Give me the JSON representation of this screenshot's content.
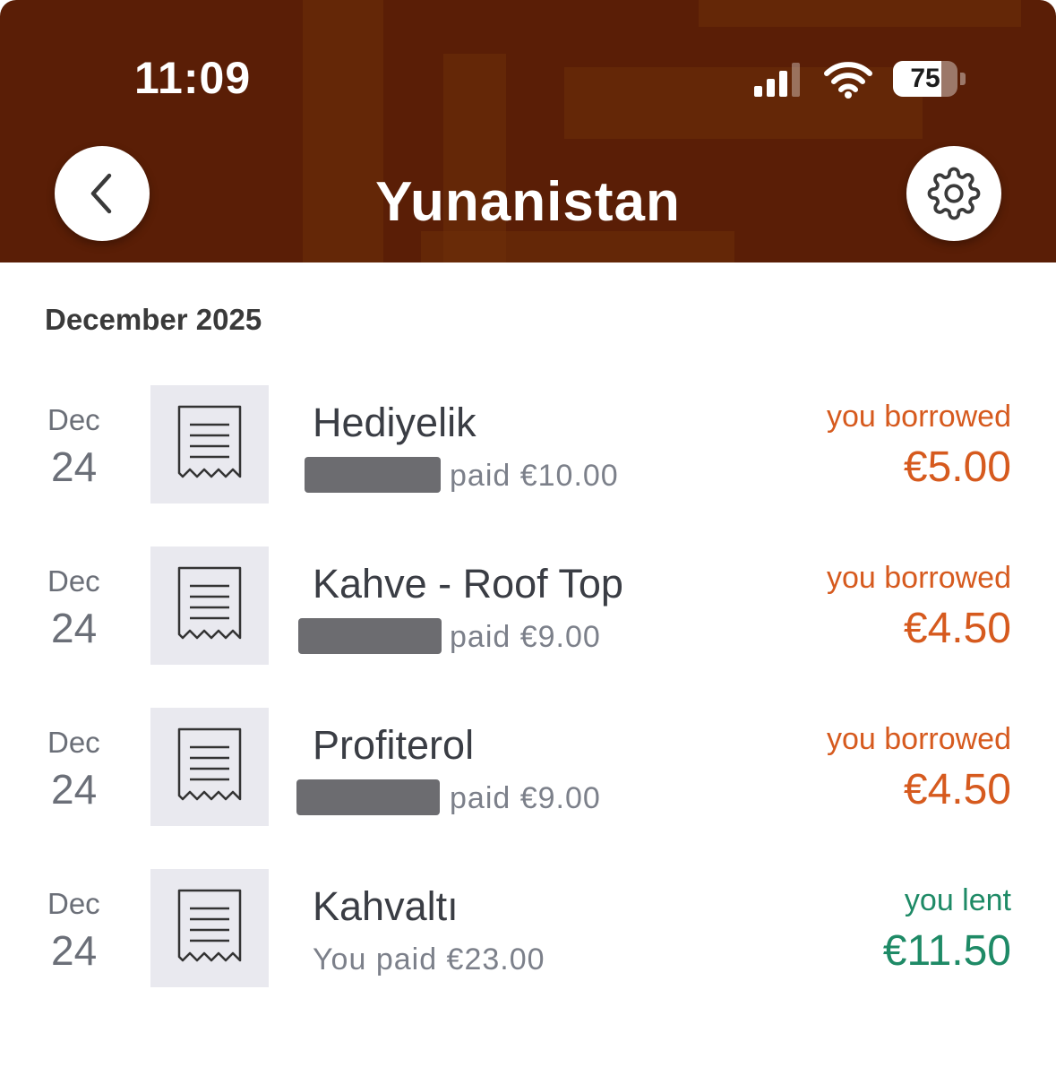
{
  "status_bar": {
    "time": "11:09",
    "battery": "75",
    "battery_level_percent": 75
  },
  "header": {
    "title": "Yunanistan",
    "back_icon": "chevron-left-icon",
    "settings_icon": "gear-icon",
    "background_color": "#5a1e06"
  },
  "section": {
    "heading": "December 2025"
  },
  "expenses": [
    {
      "month": "Dec",
      "day": "24",
      "name": "Hediyelik",
      "payer_hidden": true,
      "paid_text": "paid €10.00",
      "status": "you borrowed",
      "amount": "€5.00",
      "kind": "borrowed"
    },
    {
      "month": "Dec",
      "day": "24",
      "name": "Kahve - Roof Top",
      "payer_hidden": true,
      "paid_text": "paid €9.00",
      "status": "you borrowed",
      "amount": "€4.50",
      "kind": "borrowed"
    },
    {
      "month": "Dec",
      "day": "24",
      "name": "Profiterol",
      "payer_hidden": true,
      "paid_text": "paid €9.00",
      "status": "you borrowed",
      "amount": "€4.50",
      "kind": "borrowed"
    },
    {
      "month": "Dec",
      "day": "24",
      "name": "Kahvaltı",
      "payer_hidden": false,
      "paid_text": "You paid €23.00",
      "status": "you lent",
      "amount": "€11.50",
      "kind": "lent"
    }
  ],
  "colors": {
    "borrowed": "#d65a1e",
    "lent": "#1e8a66"
  }
}
